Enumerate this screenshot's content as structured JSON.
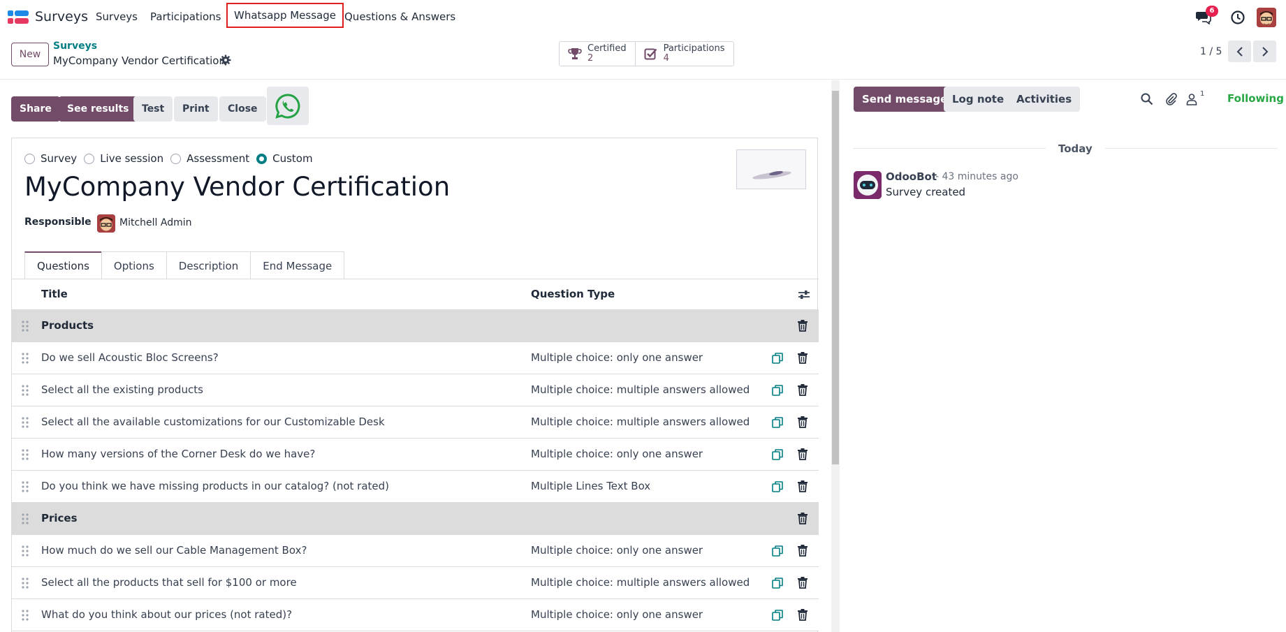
{
  "app": {
    "name": "Surveys"
  },
  "menu": {
    "items": [
      "Surveys",
      "Participations",
      "Whatsapp Message",
      "Questions & Answers"
    ]
  },
  "systray": {
    "messages_count": "6"
  },
  "control": {
    "new_label": "New",
    "breadcrumb": "Surveys",
    "record_name": "MyCompany Vendor Certification",
    "smart_buttons": [
      {
        "label": "Certified",
        "value": "2"
      },
      {
        "label": "Participations",
        "value": "4"
      }
    ],
    "pager": "1 / 5"
  },
  "actions": {
    "share": "Share",
    "see_results": "See results",
    "test": "Test",
    "print": "Print",
    "close": "Close"
  },
  "form": {
    "survey_types": [
      "Survey",
      "Live session",
      "Assessment",
      "Custom"
    ],
    "selected_type": "Custom",
    "title": "MyCompany Vendor Certification",
    "responsible_label": "Responsible",
    "responsible_name": "Mitchell Admin",
    "tabs": [
      "Questions",
      "Options",
      "Description",
      "End Message"
    ],
    "columns": {
      "title": "Title",
      "type": "Question Type"
    },
    "rows": [
      {
        "kind": "section",
        "title": "Products",
        "type": ""
      },
      {
        "kind": "question",
        "title": "Do we sell Acoustic Bloc Screens?",
        "type": "Multiple choice: only one answer"
      },
      {
        "kind": "question",
        "title": "Select all the existing products",
        "type": "Multiple choice: multiple answers allowed"
      },
      {
        "kind": "question",
        "title": "Select all the available customizations for our Customizable Desk",
        "type": "Multiple choice: multiple answers allowed"
      },
      {
        "kind": "question",
        "title": "How many versions of the Corner Desk do we have?",
        "type": "Multiple choice: only one answer"
      },
      {
        "kind": "question",
        "title": "Do you think we have missing products in our catalog? (not rated)",
        "type": "Multiple Lines Text Box"
      },
      {
        "kind": "section",
        "title": "Prices",
        "type": ""
      },
      {
        "kind": "question",
        "title": "How much do we sell our Cable Management Box?",
        "type": "Multiple choice: only one answer"
      },
      {
        "kind": "question",
        "title": "Select all the products that sell for $100 or more",
        "type": "Multiple choice: multiple answers allowed"
      },
      {
        "kind": "question",
        "title": "What do you think about our prices (not rated)?",
        "type": "Multiple choice: only one answer"
      }
    ]
  },
  "chatter": {
    "send_message": "Send message",
    "log_note": "Log note",
    "activities": "Activities",
    "followers_count": "1",
    "following": "Following",
    "date_separator": "Today",
    "messages": [
      {
        "author": "OdooBot",
        "time": "- 43 minutes ago",
        "body": "Survey created"
      }
    ]
  },
  "colors": {
    "primary": "#714b67",
    "teal": "#017e84",
    "following_green": "#28a745",
    "badge_red": "#e7214f",
    "highlight_red": "#e11d1d",
    "whatsapp_green": "#25a244"
  }
}
